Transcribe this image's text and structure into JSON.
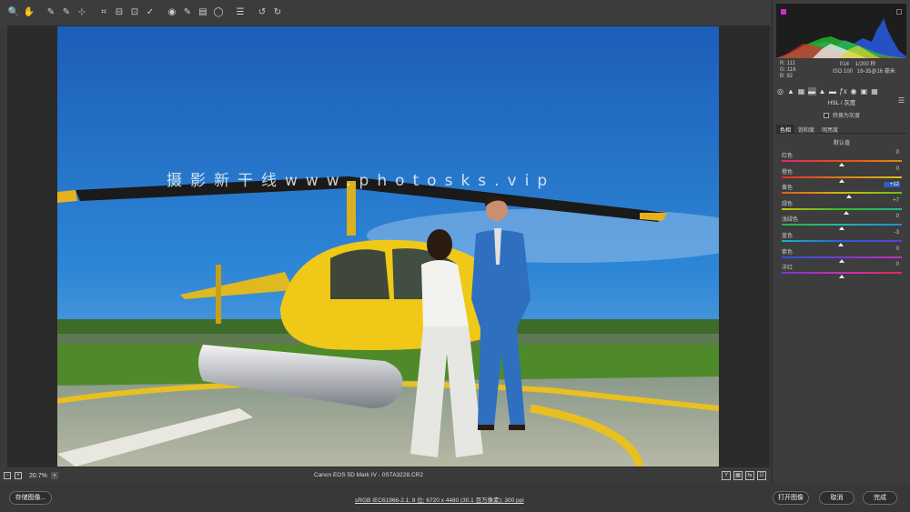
{
  "toolbar": {
    "tools": [
      "zoom-icon",
      "hand-icon",
      "white-balance-icon",
      "color-sampler-icon",
      "targeted-adjust-icon",
      "crop-icon",
      "straighten-icon",
      "transform-icon",
      "spot-removal-icon",
      "red-eye-icon",
      "adjustment-brush-icon",
      "graduated-filter-icon",
      "radial-filter-icon",
      "preferences-icon",
      "rotate-ccw-icon",
      "rotate-cw-icon"
    ],
    "tool_glyphs": [
      "🔍",
      "✋",
      "✎",
      "✎",
      "⊹",
      "⌗",
      "⊟",
      "⊡",
      "✓",
      "◉",
      "✎",
      "▤",
      "◯",
      "☰",
      "↺",
      "↻"
    ],
    "fullscreen_glyph": "⇱"
  },
  "watermark": "摄影新干线www.photosks.vip",
  "status": {
    "zoom_out": "−",
    "zoom_in": "+",
    "zoom": "20.7%",
    "zoom_dropdown": "▾",
    "filename": "Canon EOS 5D Mark IV - 0S7A3228.CR2",
    "view_buttons": [
      "Y",
      "▦",
      "⇆",
      "☷"
    ]
  },
  "bottom": {
    "save_label": "存储图像...",
    "workflow": "sRGB IEC61966-2.1; 8 位; 6720 x 4480 (30.1 百万像素); 300 ppi",
    "open_label": "打开图像",
    "cancel_label": "取消",
    "done_label": "完成"
  },
  "readout": {
    "r": "R: 111",
    "g": "G: 116",
    "b": "B: 92",
    "aperture": "f/14",
    "shutter": "1/200 秒",
    "iso": "ISO 100",
    "lens": "16-35@16 毫米"
  },
  "panel": {
    "tab_glyphs": [
      "◎",
      "▲",
      "▦",
      "▬",
      "▲",
      "▬",
      "ƒx",
      "◉",
      "▣",
      "▦"
    ],
    "title": "HSL / 灰度",
    "menu_glyph": "☰",
    "gray_convert": "转换为灰度",
    "subtabs": [
      "色相",
      "饱和度",
      "明亮度"
    ],
    "default_label": "默认值",
    "sliders": [
      {
        "name": "红色",
        "value": "0",
        "position": 0.5,
        "gradient": [
          "#e0286f",
          "#e84a1a",
          "#d88a10"
        ]
      },
      {
        "name": "橙色",
        "value": "0",
        "position": 0.5,
        "gradient": [
          "#d8302a",
          "#e07a18",
          "#d8c018"
        ]
      },
      {
        "name": "黄色",
        "value": "+12",
        "position": 0.56,
        "gradient": [
          "#e05a18",
          "#d0b818",
          "#68c020"
        ]
      },
      {
        "name": "绿色",
        "value": "+7",
        "position": 0.535,
        "gradient": [
          "#c8c018",
          "#38b828",
          "#20b888"
        ]
      },
      {
        "name": "浅绿色",
        "value": "0",
        "position": 0.5,
        "gradient": [
          "#28b838",
          "#20b8a8",
          "#2888d8"
        ]
      },
      {
        "name": "蓝色",
        "value": "-3",
        "position": 0.49,
        "gradient": [
          "#20b0c0",
          "#2860d8",
          "#6a38d0"
        ]
      },
      {
        "name": "紫色",
        "value": "0",
        "position": 0.5,
        "gradient": [
          "#2858d8",
          "#7a38d0",
          "#c030c0"
        ]
      },
      {
        "name": "洋红",
        "value": "0",
        "position": 0.5,
        "gradient": [
          "#7838d0",
          "#c830b8",
          "#e0285a"
        ]
      }
    ]
  }
}
